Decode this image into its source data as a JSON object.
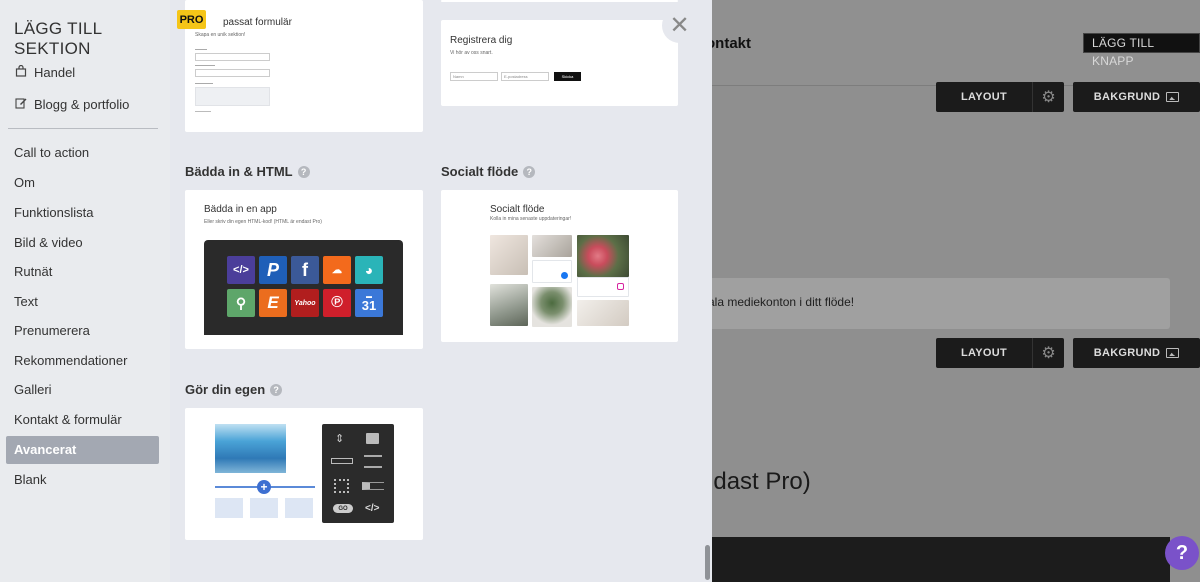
{
  "sidebar": {
    "title": "LÄGG TILL SEKTION",
    "top_items": [
      {
        "label": "Handel",
        "icon": "shopping-bag-icon"
      },
      {
        "label": "Blogg & portfolio",
        "icon": "edit-icon"
      }
    ],
    "items": [
      {
        "label": "Call to action"
      },
      {
        "label": "Om"
      },
      {
        "label": "Funktionslista"
      },
      {
        "label": "Bild & video"
      },
      {
        "label": "Rutnät"
      },
      {
        "label": "Text"
      },
      {
        "label": "Prenumerera"
      },
      {
        "label": "Rekommendationer"
      },
      {
        "label": "Galleri"
      },
      {
        "label": "Kontakt & formulär"
      },
      {
        "label": "Avancerat",
        "active": true
      },
      {
        "label": "Blank"
      }
    ]
  },
  "panel": {
    "pro_badge": "PRO",
    "cards": {
      "custom_form": {
        "title": "passat formulär",
        "subtitle": "Skapa en unik sektion!"
      },
      "register": {
        "title": "Registrera dig",
        "subtitle": "Vi hör av oss snart.",
        "field1": "Namn",
        "field2": "E-postadress",
        "button": "Skicka"
      },
      "embed": {
        "heading": "Bädda in & HTML",
        "title": "Bädda in en app",
        "subtitle": "Eller skriv din egen HTML-kod! (HTML är endast Pro)",
        "apps": [
          "code",
          "PayPal",
          "Facebook",
          "SoundCloud",
          "Mailchimp",
          "Google Maps",
          "Etsy",
          "Yahoo",
          "Pinterest",
          "Calendar"
        ],
        "calendar_day": "31"
      },
      "social": {
        "heading": "Socialt flöde",
        "title": "Socialt flöde",
        "subtitle": "Kolla in mina senaste uppdateringar!"
      },
      "own": {
        "heading": "Gör din egen",
        "go_label": "GO",
        "code_label": "</>"
      }
    }
  },
  "background": {
    "title": "ontakt",
    "add_button": "LÄGG TILL KNAPP",
    "layout_label": "LAYOUT",
    "background_label": "BAKGRUND",
    "info_text": "ala mediekonton i ditt flöde!",
    "big_text": "ndast Pro)"
  },
  "help": {
    "label": "?"
  },
  "colors": {
    "pro_badge": "#f5c518",
    "help_button": "#7a52c9",
    "active_item": "#a3a8b2",
    "panel_bg": "#e6e8ee",
    "sidebar_bg": "#e9ebee"
  }
}
